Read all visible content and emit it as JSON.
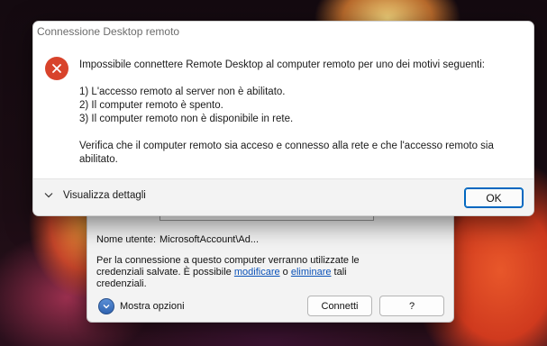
{
  "rdp_window": {
    "username_label": "Nome utente:",
    "username_value": "MicrosoftAccount\\Ad...",
    "info_text_1": "Per la connessione a questo computer verranno utilizzate le credenziali salvate. È possibile ",
    "info_link_modify": "modificare",
    "info_text_2": " o ",
    "info_link_delete": "eliminare",
    "info_text_3": " tali credenziali.",
    "options_label": "Mostra opzioni",
    "connect_label": "Connetti",
    "help_label": "?"
  },
  "dialog": {
    "title": "Connessione Desktop remoto",
    "icon": "error-icon",
    "message_intro": "Impossibile connettere Remote Desktop al computer remoto per uno dei motivi seguenti:",
    "reasons": [
      "1) L'accesso remoto al server non è abilitato.",
      "2) Il computer remoto è spento.",
      "3) Il computer remoto non è disponibile in rete."
    ],
    "message_outro": "Verifica che il computer remoto sia acceso e connesso alla rete e che l'accesso remoto sia abilitato.",
    "details_label": "Visualizza dettagli",
    "ok_label": "OK"
  },
  "colors": {
    "error_red": "#d8432b",
    "accent_blue": "#0067c0",
    "link_blue": "#0a52b8"
  }
}
